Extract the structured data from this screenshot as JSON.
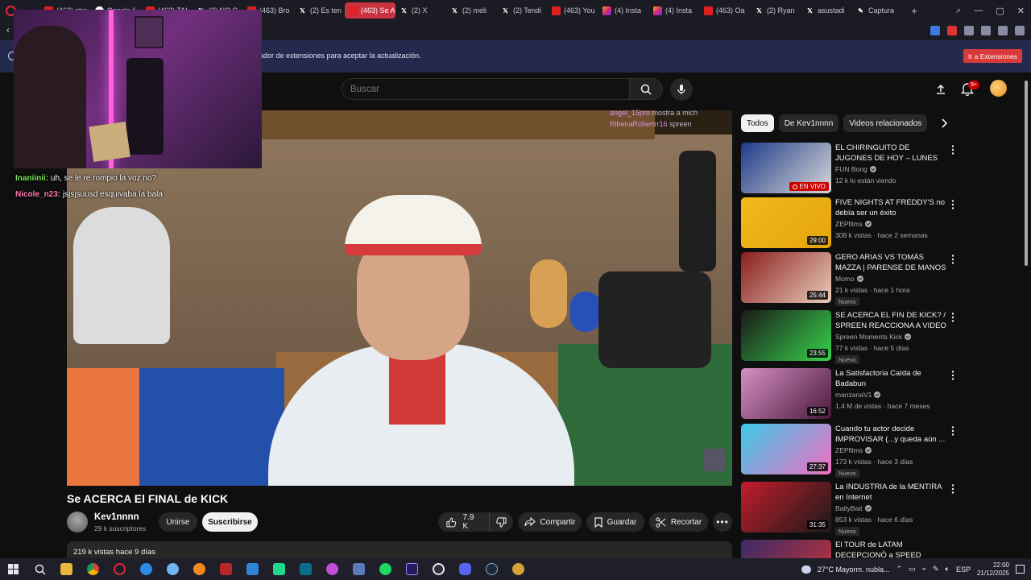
{
  "browser": {
    "tabs": [
      {
        "label": "(463) stre",
        "icon": "youtube-icon"
      },
      {
        "label": "Google li",
        "icon": "google-icon"
      },
      {
        "label": "(463) TAI",
        "icon": "youtube-icon"
      },
      {
        "label": "(2) NO C",
        "icon": "x-icon"
      },
      {
        "label": "(463) Bro",
        "icon": "youtube-icon"
      },
      {
        "label": "(2) Es ten",
        "icon": "x-icon"
      },
      {
        "label": "(463) Se ACE",
        "icon": "youtube-icon",
        "active": true
      },
      {
        "label": "(2) X",
        "icon": "x-icon"
      },
      {
        "label": "(2) meli",
        "icon": "x-icon"
      },
      {
        "label": "(2) Tendi",
        "icon": "x-icon"
      },
      {
        "label": "(463) You",
        "icon": "youtube-icon"
      },
      {
        "label": "(4) Insta",
        "icon": "instagram-icon"
      },
      {
        "label": "(4) Insta",
        "icon": "instagram-icon"
      },
      {
        "label": "(463) Oa",
        "icon": "youtube-icon"
      },
      {
        "label": "(2) Ryan",
        "icon": "x-icon"
      },
      {
        "label": "asustadi",
        "icon": "x-icon"
      },
      {
        "label": "Captura",
        "icon": "pen-icon"
      }
    ],
    "new_tab": "+"
  },
  "banner": {
    "text": "ador de extensiones para aceptar la actualización.",
    "button": "Ir a Extensiones"
  },
  "youtube": {
    "search_placeholder": "Buscar",
    "notifications_badge": "9+"
  },
  "overlay": {
    "chat": [
      {
        "user": "Inaniinii:",
        "message": "uh, se le re rompio la voz no?"
      },
      {
        "user": "Nicole_n23:",
        "message": "jsjsjsuusd esquivaba la bala"
      }
    ],
    "stream_chat": [
      {
        "user": "angel_15pro",
        "message": "mostra a mich"
      },
      {
        "user": "RibeiraRobertrr16",
        "message": "spreen"
      }
    ]
  },
  "video": {
    "title": "Se ACERCA El FINAL de KICK",
    "channel": "Kev1nnnn",
    "subscribers": "29 k suscriptores",
    "join_label": "Unirse",
    "subscribe_label": "Suscribirse",
    "likes": "7.9 K",
    "share_label": "Compartir",
    "save_label": "Guardar",
    "clip_label": "Recortar",
    "views_date": "219 k vistas  hace 9 días"
  },
  "sidebar": {
    "chips": [
      "Todos",
      "De Kev1nnnn",
      "Videos relacionados"
    ],
    "recommendations": [
      {
        "title": "EL CHIRINGUITO DE JUGONES DE HOY – LUNES 21 DE ...",
        "channel": "FUN Bong",
        "meta": "12 k lo están viendo",
        "duration": "EN VIVO",
        "live": true,
        "nuevo": "",
        "colors": [
          "#1e3a8a",
          "#d9d9d9"
        ]
      },
      {
        "title": "FIVE NIGHTS AT FREDDY'S no debía ser un éxito",
        "channel": "ZEPfilms",
        "meta": "308 k vistas · hace 2 semanas",
        "duration": "29:00",
        "live": false,
        "nuevo": "",
        "colors": [
          "#f2b81c",
          "#e4a50c"
        ]
      },
      {
        "title": "GERO ARIAS VS TOMÁS MAZZA | PARENSE DE MANOS 3",
        "channel": "Momo",
        "meta": "21 k vistas · hace 1 hora",
        "duration": "25:44",
        "live": false,
        "nuevo": "Nuevo",
        "colors": [
          "#8b1e1e",
          "#e8cdb9"
        ]
      },
      {
        "title": "SE ACERCA EL FIN DE KICK? / SPREEN REACCIONA A VIDEO ...",
        "channel": "Spreen Moments Kick",
        "meta": "77 k vistas · hace 5 días",
        "duration": "23:55",
        "live": false,
        "nuevo": "Nuevo",
        "colors": [
          "#1a1a1a",
          "#37d34c"
        ]
      },
      {
        "title": "La Satisfactoria Caída de Badabun",
        "channel": "manzanaV1",
        "meta": "1.4 M de vistas · hace 7 meses",
        "duration": "16:52",
        "live": false,
        "nuevo": "",
        "colors": [
          "#d58fc5",
          "#4a1a3a"
        ]
      },
      {
        "title": "Cuando tu actor decide IMPROVISAR (...y queda aún ...",
        "channel": "ZEPfilms",
        "meta": "173 k vistas · hace 3 días",
        "duration": "27:37",
        "live": false,
        "nuevo": "Nuevo",
        "colors": [
          "#3cc9e8",
          "#f26fc1"
        ]
      },
      {
        "title": "La INDUSTRIA de la MENTIRA en Internet",
        "channel": "BaityBait",
        "meta": "853 k vistas · hace 6 días",
        "duration": "31:35",
        "live": false,
        "nuevo": "Nuevo",
        "colors": [
          "#c21d2b",
          "#1a1a1a"
        ]
      },
      {
        "title": "El TOUR de LATAM DECEPCIONÓ a SPEED",
        "channel": "",
        "meta": "",
        "duration": "",
        "live": false,
        "nuevo": "",
        "colors": [
          "#3a2a6a",
          "#cc3333"
        ]
      }
    ]
  },
  "taskbar": {
    "weather": "27°C  Mayorm. nubla...",
    "language": "ESP",
    "time": "22:00",
    "date": "21/12/2025"
  }
}
